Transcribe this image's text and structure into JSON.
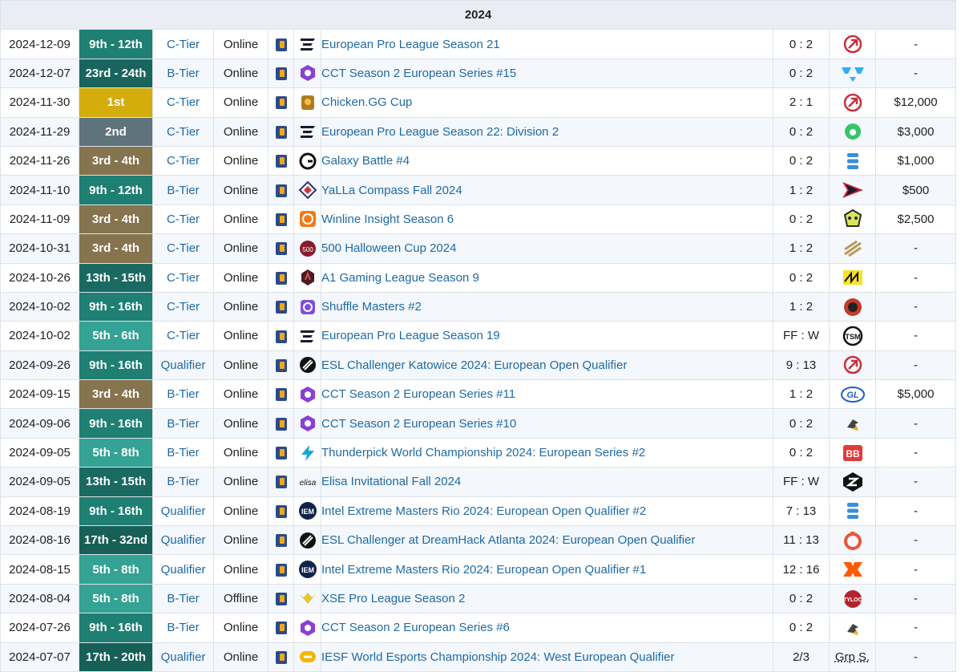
{
  "year": "2024",
  "colors": {
    "place_1st": "#d8b20f",
    "place_2nd": "#637780",
    "place_3rd": "#8a7653",
    "place_9th": "#1e7a6f",
    "place_5th": "#37a69a",
    "link": "#1f6aa5"
  },
  "rows": [
    {
      "date": "2024-12-09",
      "place": "9th - 12th",
      "place_color": "#1f7f73",
      "tier": "C-Tier",
      "type": "Online",
      "tournament_icon": "epl-icon",
      "tournament": "European Pro League Season 21",
      "score": "0 : 2",
      "opponent_icon": "rocket-team-icon",
      "prize": "-"
    },
    {
      "date": "2024-12-07",
      "place": "23rd - 24th",
      "place_color": "#19655d",
      "tier": "B-Tier",
      "type": "Online",
      "tournament_icon": "cct-icon",
      "tournament": "CCT Season 2 European Series #15",
      "score": "0 : 2",
      "opponent_icon": "wings-team-icon",
      "prize": "-"
    },
    {
      "date": "2024-11-30",
      "place": "1st",
      "place_color": "#d4ad0d",
      "tier": "C-Tier",
      "type": "Online",
      "tournament_icon": "chicken-gg-icon",
      "tournament": "Chicken.GG Cup",
      "score": "2 : 1",
      "opponent_icon": "rocket-team-icon",
      "prize": "$12,000"
    },
    {
      "date": "2024-11-29",
      "place": "2nd",
      "place_color": "#5f737d",
      "tier": "C-Tier",
      "type": "Online",
      "tournament_icon": "epl-icon",
      "tournament": "European Pro League Season 22: Division 2",
      "score": "0 : 2",
      "opponent_icon": "bestia-team-icon",
      "prize": "$3,000"
    },
    {
      "date": "2024-11-26",
      "place": "3rd - 4th",
      "place_color": "#86744f",
      "tier": "C-Tier",
      "type": "Online",
      "tournament_icon": "galaxy-battle-icon",
      "tournament": "Galaxy Battle #4",
      "score": "0 : 2",
      "opponent_icon": "stacked-team-icon",
      "prize": "$1,000"
    },
    {
      "date": "2024-11-10",
      "place": "9th - 12th",
      "place_color": "#1f7f73",
      "tier": "B-Tier",
      "type": "Online",
      "tournament_icon": "yalla-compass-icon",
      "tournament": "YaLLa Compass Fall 2024",
      "score": "1 : 2",
      "opponent_icon": "arrow-team-icon",
      "prize": "$500"
    },
    {
      "date": "2024-11-09",
      "place": "3rd - 4th",
      "place_color": "#86744f",
      "tier": "C-Tier",
      "type": "Online",
      "tournament_icon": "winline-icon",
      "tournament": "Winline Insight Season 6",
      "score": "0 : 2",
      "opponent_icon": "skull-team-icon",
      "prize": "$2,500"
    },
    {
      "date": "2024-10-31",
      "place": "3rd - 4th",
      "place_color": "#86744f",
      "tier": "C-Tier",
      "type": "Online",
      "tournament_icon": "500-icon",
      "tournament": "500 Halloween Cup 2024",
      "score": "1 : 2",
      "opponent_icon": "eternal-team-icon",
      "prize": "-"
    },
    {
      "date": "2024-10-26",
      "place": "13th - 15th",
      "place_color": "#1a6a62",
      "tier": "C-Tier",
      "type": "Online",
      "tournament_icon": "a1-gaming-icon",
      "tournament": "A1 Gaming League Season 9",
      "score": "0 : 2",
      "opponent_icon": "navi-team-icon",
      "prize": "-"
    },
    {
      "date": "2024-10-02",
      "place": "9th - 16th",
      "place_color": "#1f7f73",
      "tier": "C-Tier",
      "type": "Online",
      "tournament_icon": "shuffle-icon",
      "tournament": "Shuffle Masters #2",
      "score": "1 : 2",
      "opponent_icon": "red-orb-team-icon",
      "prize": "-"
    },
    {
      "date": "2024-10-02",
      "place": "5th - 6th",
      "place_color": "#34a294",
      "tier": "C-Tier",
      "type": "Online",
      "tournament_icon": "epl-icon",
      "tournament": "European Pro League Season 19",
      "score": "FF : W",
      "opponent_icon": "tsm-team-icon",
      "prize": "-"
    },
    {
      "date": "2024-09-26",
      "place": "9th - 16th",
      "place_color": "#1f7f73",
      "tier": "Qualifier",
      "type": "Online",
      "tournament_icon": "esl-icon",
      "tournament": "ESL Challenger Katowice 2024: European Open Qualifier",
      "score": "9 : 13",
      "opponent_icon": "rocket-team-icon",
      "prize": "-"
    },
    {
      "date": "2024-09-15",
      "place": "3rd - 4th",
      "place_color": "#86744f",
      "tier": "B-Tier",
      "type": "Online",
      "tournament_icon": "cct-icon",
      "tournament": "CCT Season 2 European Series #11",
      "score": "1 : 2",
      "opponent_icon": "gl-team-icon",
      "prize": "$5,000"
    },
    {
      "date": "2024-09-06",
      "place": "9th - 16th",
      "place_color": "#1f7f73",
      "tier": "B-Tier",
      "type": "Online",
      "tournament_icon": "cct-icon",
      "tournament": "CCT Season 2 European Series #10",
      "score": "0 : 2",
      "opponent_icon": "bird-team-icon",
      "prize": "-"
    },
    {
      "date": "2024-09-05",
      "place": "5th - 8th",
      "place_color": "#34a294",
      "tier": "B-Tier",
      "type": "Online",
      "tournament_icon": "thunderpick-icon",
      "tournament": "Thunderpick World Championship 2024: European Series #2",
      "score": "0 : 2",
      "opponent_icon": "bb-team-icon",
      "prize": "-"
    },
    {
      "date": "2024-09-05",
      "place": "13th - 15th",
      "place_color": "#1a6a62",
      "tier": "B-Tier",
      "type": "Online",
      "tournament_icon": "elisa-icon",
      "tournament": "Elisa Invitational Fall 2024",
      "score": "FF : W",
      "opponent_icon": "sinners-team-icon",
      "prize": "-"
    },
    {
      "date": "2024-08-19",
      "place": "9th - 16th",
      "place_color": "#1f7f73",
      "tier": "Qualifier",
      "type": "Online",
      "tournament_icon": "iem-icon",
      "tournament": "Intel Extreme Masters Rio 2024: European Open Qualifier #2",
      "score": "7 : 13",
      "opponent_icon": "stacked-team-icon",
      "prize": "-"
    },
    {
      "date": "2024-08-16",
      "place": "17th - 32nd",
      "place_color": "#176058",
      "tier": "Qualifier",
      "type": "Online",
      "tournament_icon": "esl-icon",
      "tournament": "ESL Challenger at DreamHack Atlanta 2024: European Open Qualifier",
      "score": "11 : 13",
      "opponent_icon": "ring-team-icon",
      "prize": "-"
    },
    {
      "date": "2024-08-15",
      "place": "5th - 8th",
      "place_color": "#34a294",
      "tier": "Qualifier",
      "type": "Online",
      "tournament_icon": "iem-icon",
      "tournament": "Intel Extreme Masters Rio 2024: European Open Qualifier #1",
      "score": "12 : 16",
      "opponent_icon": "fnatic-team-icon",
      "prize": "-"
    },
    {
      "date": "2024-08-04",
      "place": "5th - 8th",
      "place_color": "#34a294",
      "tier": "B-Tier",
      "type": "Offline",
      "tournament_icon": "xse-icon",
      "tournament": "XSE Pro League Season 2",
      "score": "0 : 2",
      "opponent_icon": "tyloo-team-icon",
      "prize": "-"
    },
    {
      "date": "2024-07-26",
      "place": "9th - 16th",
      "place_color": "#1f7f73",
      "tier": "B-Tier",
      "type": "Online",
      "tournament_icon": "cct-icon",
      "tournament": "CCT Season 2 European Series #6",
      "score": "0 : 2",
      "opponent_icon": "bird-team-icon",
      "prize": "-"
    },
    {
      "date": "2024-07-07",
      "place": "17th - 20th",
      "place_color": "#176058",
      "tier": "Qualifier",
      "type": "Online",
      "tournament_icon": "iesf-icon",
      "tournament": "IESF World Esports Championship 2024: West European Qualifier",
      "score": "2/3",
      "opponent_icon": "",
      "opponent_text": "Grp S.",
      "prize": "-"
    }
  ]
}
